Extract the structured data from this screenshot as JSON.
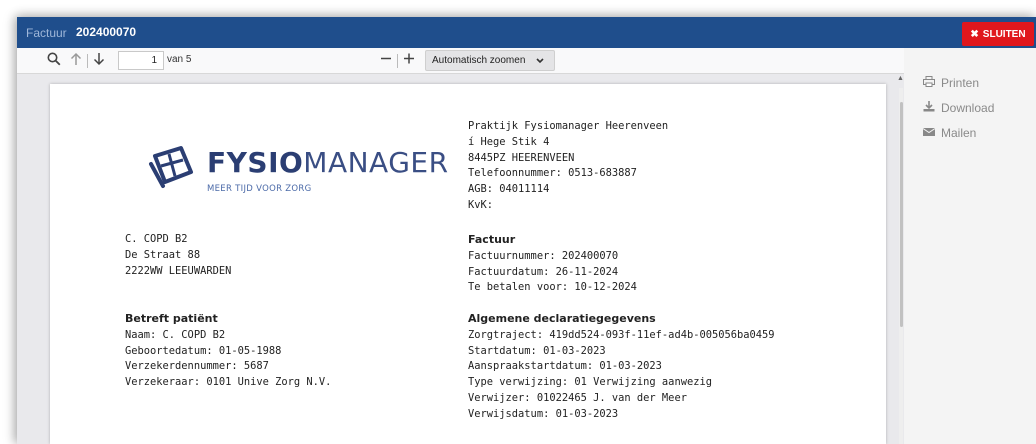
{
  "titlebar": {
    "prefix": "Factuur",
    "number": "202400070",
    "close_label": "SLUITEN"
  },
  "toolbar": {
    "page_current": "1",
    "page_of": "van 5",
    "zoom_label": "Automatisch zoomen"
  },
  "sidebar": {
    "items": [
      {
        "label": "Printen",
        "icon": "print-icon"
      },
      {
        "label": "Download",
        "icon": "download-icon"
      },
      {
        "label": "Mailen",
        "icon": "mail-icon"
      }
    ]
  },
  "document": {
    "logo": {
      "word_strong": "FYSIO",
      "word_light": "MANAGER",
      "tagline": "MEER TIJD VOOR ZORG"
    },
    "practice": {
      "lines": [
        "Praktijk Fysiomanager Heerenveen",
        "í Hege Stik 4",
        "8445PZ HEERENVEEN",
        "Telefoonnummer: 0513-683887",
        "AGB: 04011114",
        "KvK:"
      ]
    },
    "recipient": {
      "lines": [
        "C. COPD B2",
        "De Straat 88",
        "2222WW LEEUWARDEN"
      ]
    },
    "invoice": {
      "heading": "Factuur",
      "lines": [
        "Factuurnummer: 202400070",
        "Factuurdatum: 26-11-2024",
        "Te betalen voor: 10-12-2024"
      ]
    },
    "patient": {
      "heading": "Betreft patiënt",
      "lines": [
        "Naam: C. COPD B2",
        "Geboortedatum: 01-05-1988",
        "Verzekerdennummer: 5687",
        "Verzekeraar: 0101 Unive Zorg N.V."
      ]
    },
    "declaration": {
      "heading": "Algemene declaratiegegevens",
      "lines": [
        "Zorgtraject: 419dd524-093f-11ef-ad4b-005056ba0459",
        "Startdatum: 01-03-2023",
        "Aanspraakstartdatum: 01-03-2023",
        "Type verwijzing: 01 Verwijzing aanwezig",
        "Verwijzer: 01022465 J. van der Meer",
        "Verwijsdatum: 01-03-2023"
      ]
    }
  }
}
